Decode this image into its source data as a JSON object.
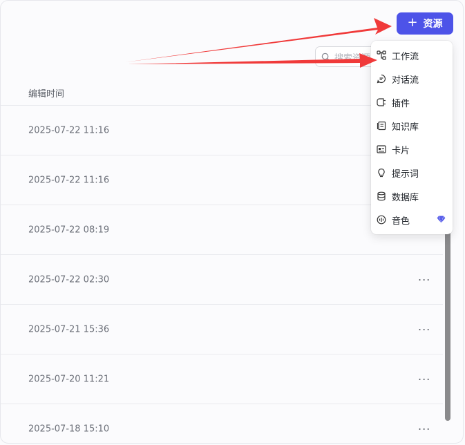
{
  "toolbar": {
    "add_label": "资源",
    "add_icon": "plus-icon",
    "search_placeholder": "搜索资源"
  },
  "table": {
    "column_header": "编辑时间",
    "rows": [
      {
        "time": "2025-07-22 11:16",
        "more": "···"
      },
      {
        "time": "2025-07-22 11:16",
        "more": "···"
      },
      {
        "time": "2025-07-22 08:19",
        "more": "···"
      },
      {
        "time": "2025-07-22 02:30",
        "more": "···"
      },
      {
        "time": "2025-07-21 15:36",
        "more": "···"
      },
      {
        "time": "2025-07-20 11:21",
        "more": "···"
      },
      {
        "time": "2025-07-18 15:10",
        "more": "···"
      }
    ]
  },
  "menu": {
    "items": [
      {
        "label": "工作流",
        "icon": "workflow-icon"
      },
      {
        "label": "对话流",
        "icon": "chatflow-icon"
      },
      {
        "label": "插件",
        "icon": "plugin-icon"
      },
      {
        "label": "知识库",
        "icon": "knowledge-icon"
      },
      {
        "label": "卡片",
        "icon": "card-icon"
      },
      {
        "label": "提示词",
        "icon": "prompt-icon"
      },
      {
        "label": "数据库",
        "icon": "database-icon"
      },
      {
        "label": "音色",
        "icon": "voice-icon",
        "badge": "diamond-icon"
      }
    ]
  },
  "colors": {
    "accent": "#4d53e8",
    "annotation_arrow": "#f03a3a",
    "premium_badge": "#4d53e8"
  }
}
